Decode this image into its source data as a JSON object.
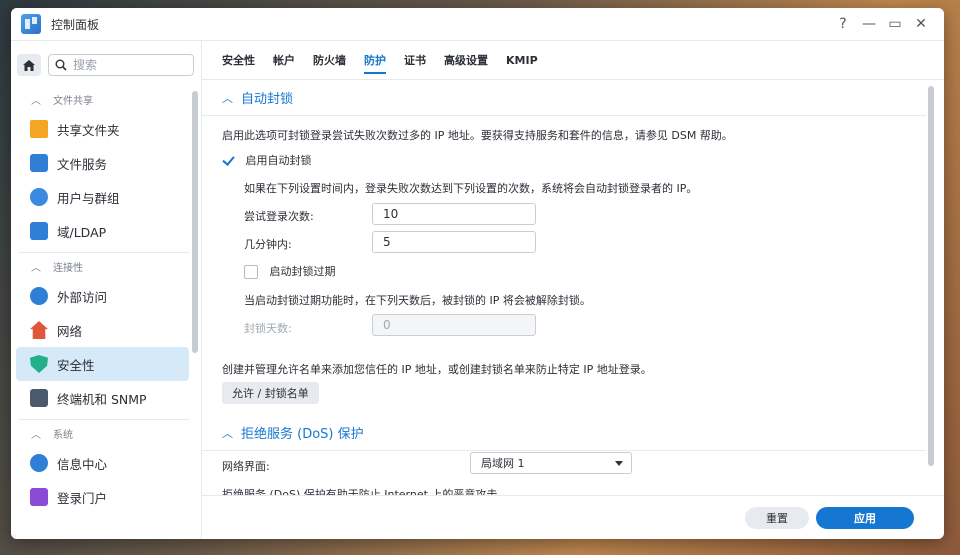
{
  "window": {
    "title": "控制面板"
  },
  "window_controls": [
    "?",
    "—",
    "▭",
    "✕"
  ],
  "search": {
    "placeholder": "搜索"
  },
  "sidebar": {
    "groups": [
      {
        "label": "文件共享",
        "items": [
          {
            "label": "共享文件夹",
            "icon": "shared-folder-icon",
            "color": "#f4a623"
          },
          {
            "label": "文件服务",
            "icon": "file-services-icon",
            "color": "#2f7fd6"
          },
          {
            "label": "用户与群组",
            "icon": "user-group-icon",
            "color": "#3a8be0"
          },
          {
            "label": "域/LDAP",
            "icon": "domain-ldap-icon",
            "color": "#2f7fd6"
          }
        ]
      },
      {
        "label": "连接性",
        "items": [
          {
            "label": "外部访问",
            "icon": "external-access-icon",
            "color": "#2f7fd6"
          },
          {
            "label": "网络",
            "icon": "network-icon",
            "color": "#e0563a"
          },
          {
            "label": "安全性",
            "icon": "security-shield-icon",
            "color": "#21b08a",
            "active": true
          },
          {
            "label": "终端机和 SNMP",
            "icon": "terminal-icon",
            "color": "#4a5a6a"
          }
        ]
      },
      {
        "label": "系统",
        "items": [
          {
            "label": "信息中心",
            "icon": "info-center-icon",
            "color": "#2f7fd6"
          },
          {
            "label": "登录门户",
            "icon": "login-portal-icon",
            "color": "#8a4bd6"
          }
        ]
      }
    ]
  },
  "tabs": [
    {
      "label": "安全性"
    },
    {
      "label": "帐户"
    },
    {
      "label": "防火墙"
    },
    {
      "label": "防护",
      "active": true
    },
    {
      "label": "证书"
    },
    {
      "label": "高级设置"
    },
    {
      "label": "KMIP"
    }
  ],
  "autoblock": {
    "section_title": "自动封锁",
    "description": "启用此选项可封锁登录尝试失败次数过多的 IP 地址。要获得支持服务和套件的信息，请参见 DSM 帮助。",
    "enable_label": "启用自动封锁",
    "enable_checked": true,
    "rule_text": "如果在下列设置时间内，登录失败次数达到下列设置的次数，系统将会自动封锁登录者的 IP。",
    "attempts_label": "尝试登录次数:",
    "attempts_value": "10",
    "minutes_label": "几分钟内:",
    "minutes_value": "5",
    "expire_label": "启动封锁过期",
    "expire_checked": false,
    "expire_text": "当启动封锁过期功能时，在下列天数后，被封锁的 IP 将会被解除封锁。",
    "days_label": "封锁天数:",
    "days_value": "0",
    "allow_text": "创建并管理允许名单来添加您信任的 IP 地址，或创建封锁名单来防止特定 IP 地址登录。",
    "allow_button": "允许 / 封锁名单"
  },
  "dos": {
    "section_title": "拒绝服务 (DoS) 保护",
    "iface_label": "网络界面:",
    "iface_value": "局域网 1",
    "note": "拒绝服务 (DoS) 保护有助于防止 Internet 上的恶意攻击。"
  },
  "footer": {
    "reset": "重置",
    "apply": "应用"
  },
  "colors": {
    "accent": "#1677d2",
    "active_bg": "#d5e9f9"
  }
}
